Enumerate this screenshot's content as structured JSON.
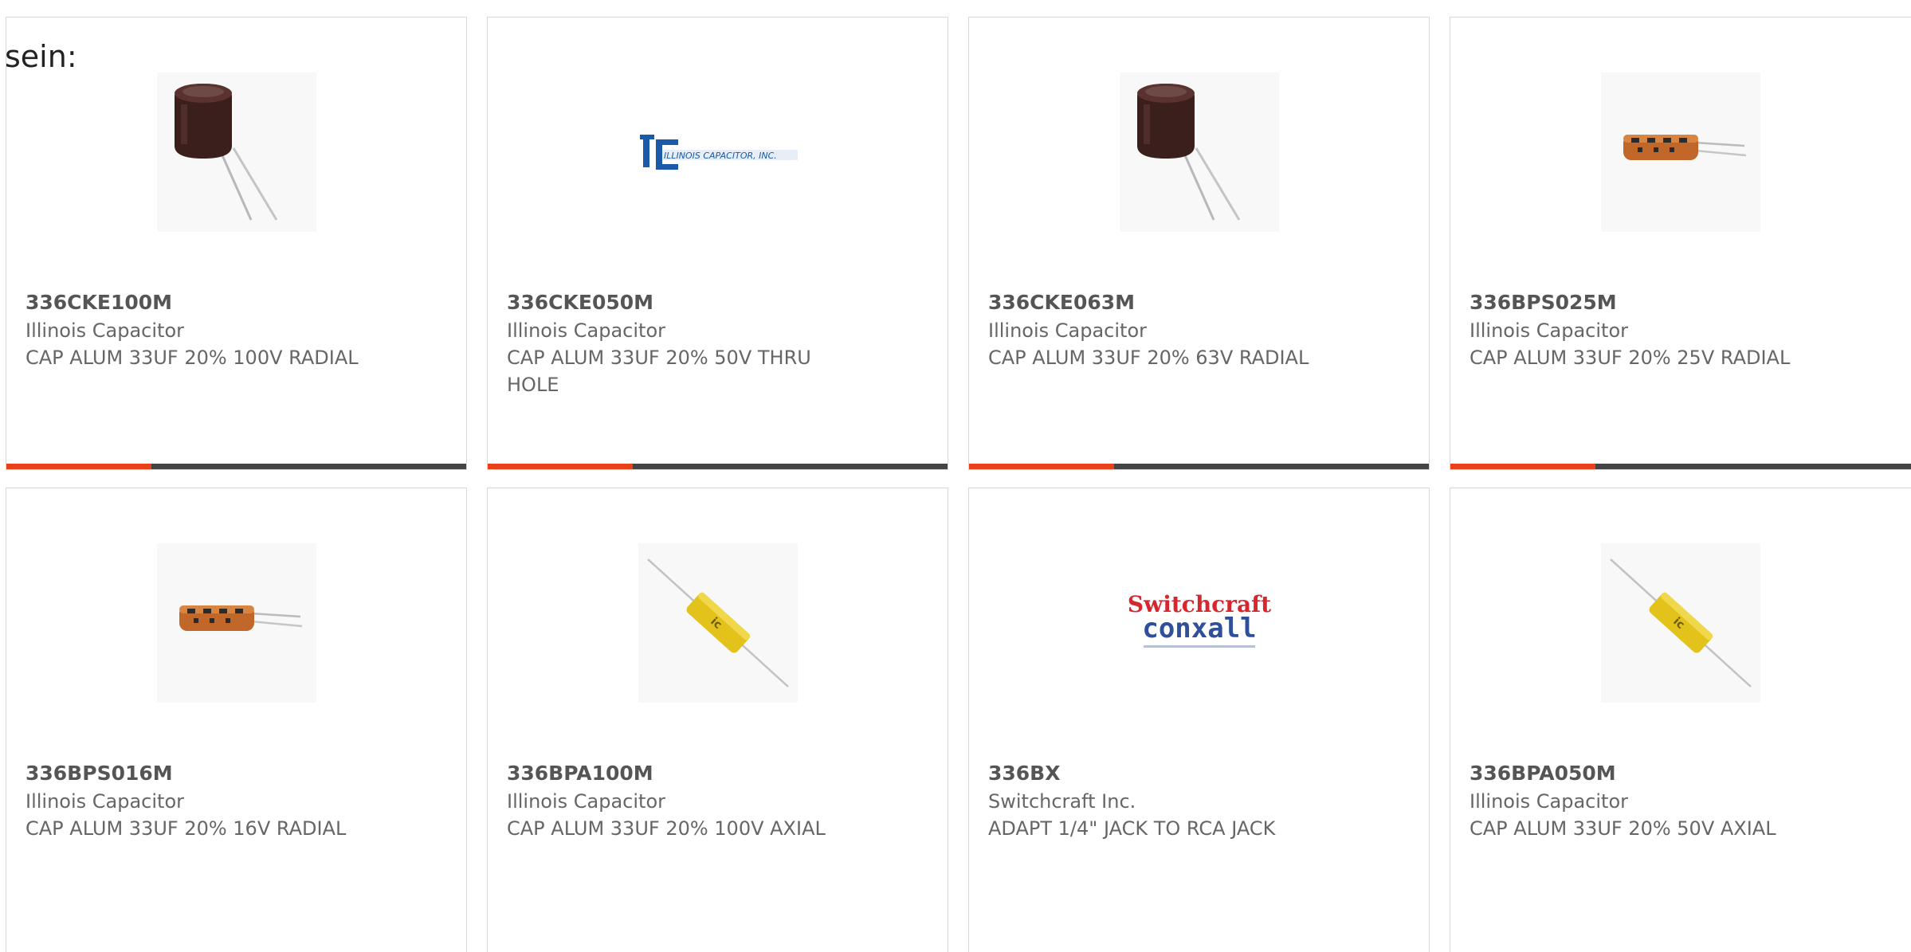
{
  "intro_text": "sein:",
  "colors": {
    "accent": "#e8411a",
    "bar_dark": "#444444",
    "border": "#d8d8d8",
    "text": "#666666"
  },
  "products": [
    {
      "part": "336CKE100M",
      "manufacturer": "Illinois Capacitor",
      "description": "CAP ALUM 33UF 20% 100V RADIAL",
      "image": "radial-electrolytic-capacitor-photo"
    },
    {
      "part": "336CKE050M",
      "manufacturer": "Illinois Capacitor",
      "description": "CAP ALUM 33UF 20% 50V THRU HOLE",
      "image": "illinois-capacitor-logo",
      "logo_text": "ILLINOIS CAPACITOR, INC."
    },
    {
      "part": "336CKE063M",
      "manufacturer": "Illinois Capacitor",
      "description": "CAP ALUM 33UF 20% 63V RADIAL",
      "image": "radial-electrolytic-capacitor-photo"
    },
    {
      "part": "336BPS025M",
      "manufacturer": "Illinois Capacitor",
      "description": "CAP ALUM 33UF 20% 25V RADIAL",
      "image": "orange-bipolar-capacitor-photo"
    },
    {
      "part": "336BPS016M",
      "manufacturer": "Illinois Capacitor",
      "description": "CAP ALUM 33UF 20% 16V RADIAL",
      "image": "orange-bipolar-capacitor-photo"
    },
    {
      "part": "336BPA100M",
      "manufacturer": "Illinois Capacitor",
      "description": "CAP ALUM 33UF 20% 100V AXIAL",
      "image": "yellow-axial-capacitor-photo"
    },
    {
      "part": "336BX",
      "manufacturer": "Switchcraft Inc.",
      "description": "ADAPT 1/4\" JACK TO RCA JACK",
      "image": "switchcraft-conxall-logo",
      "logo_text": "Switchcraft conxall"
    },
    {
      "part": "336BPA050M",
      "manufacturer": "Illinois Capacitor",
      "description": "CAP ALUM 33UF 20% 50V AXIAL",
      "image": "yellow-axial-capacitor-photo"
    }
  ]
}
